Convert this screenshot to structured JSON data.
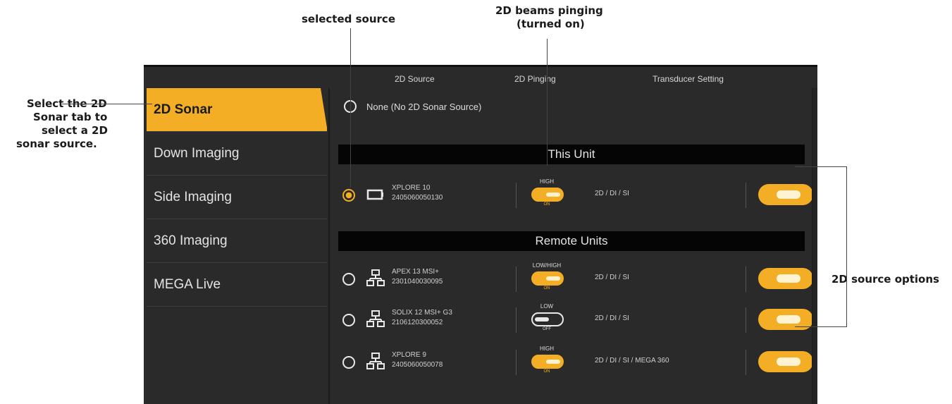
{
  "callouts": {
    "selected_source": "selected source",
    "beams_line1": "2D beams pinging",
    "beams_line2": "(turned on)",
    "tab_line1": "Select the 2D",
    "tab_line2": "Sonar tab to",
    "tab_line3": "select a 2D",
    "tab_line4": "sonar source.",
    "options": "2D source options"
  },
  "columns": {
    "source": "2D Source",
    "pinging": "2D Pinging",
    "transducer": "Transducer Setting"
  },
  "sidebar": {
    "items": [
      {
        "label": "2D Sonar",
        "active": true
      },
      {
        "label": "Down Imaging",
        "active": false
      },
      {
        "label": "Side Imaging",
        "active": false
      },
      {
        "label": "360 Imaging",
        "active": false
      },
      {
        "label": "MEGA Live",
        "active": false
      }
    ]
  },
  "none_option": {
    "label": "None (No 2D Sonar Source)",
    "selected": false
  },
  "sections": {
    "this_unit": "This Unit",
    "remote_units": "Remote Units"
  },
  "sources": [
    {
      "icon": "display-unit-icon",
      "name": "XPLORE 10",
      "serial": "2405060050130",
      "freq": "HIGH",
      "ping_on": true,
      "ping_state": "ON",
      "caps": "2D / DI / SI",
      "selected": true,
      "enabled": true
    },
    {
      "icon": "network-icon",
      "name": "APEX 13 MSI+",
      "serial": "2301040030095",
      "freq": "LOW/HIGH",
      "ping_on": true,
      "ping_state": "ON",
      "caps": "2D / DI / SI",
      "selected": false,
      "enabled": true
    },
    {
      "icon": "network-icon",
      "name": "SOLIX 12 MSI+ G3",
      "serial": "2106120300052",
      "freq": "LOW",
      "ping_on": false,
      "ping_state": "OFF",
      "caps": "2D / DI / SI",
      "selected": false,
      "enabled": true
    },
    {
      "icon": "network-icon",
      "name": "XPLORE 9",
      "serial": "2405060050078",
      "freq": "HIGH",
      "ping_on": true,
      "ping_state": "ON",
      "caps": "2D / DI / SI / MEGA 360",
      "selected": false,
      "enabled": true
    }
  ],
  "colors": {
    "accent": "#f3ae26",
    "background": "#2a2a2a",
    "section_bar": "#050505"
  }
}
